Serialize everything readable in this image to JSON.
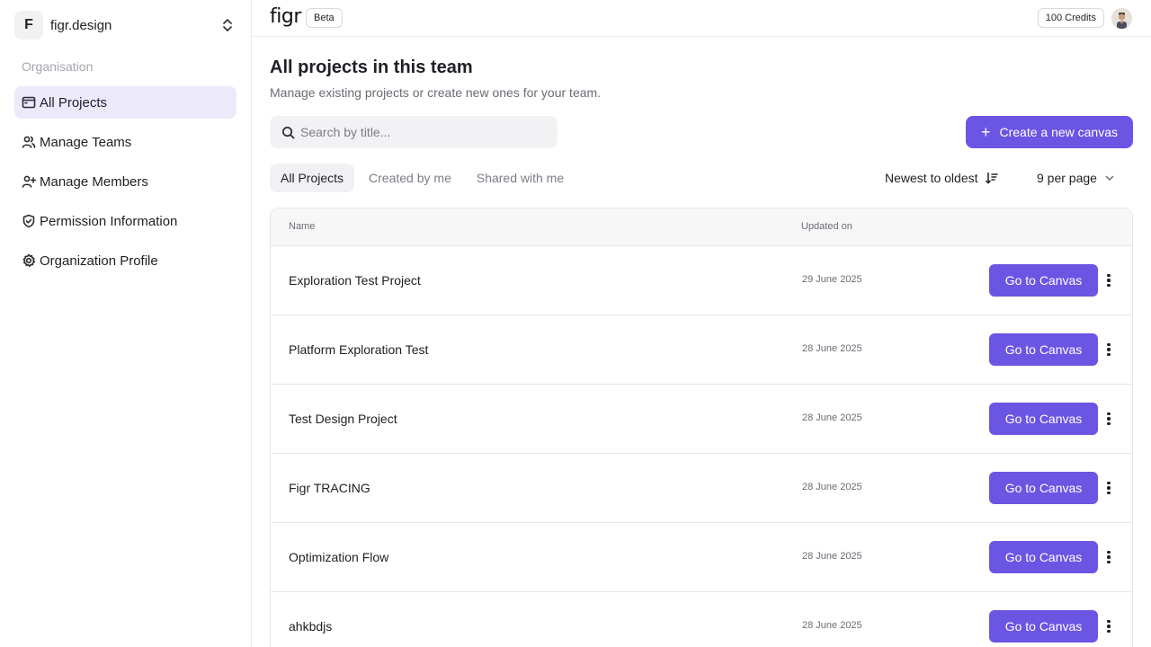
{
  "team": {
    "initial": "F",
    "name": "figr.design"
  },
  "sidebar": {
    "section_label": "Organisation",
    "items": [
      {
        "label": "All Projects",
        "icon": "projects-icon",
        "active": true
      },
      {
        "label": "Manage Teams",
        "icon": "users-icon"
      },
      {
        "label": "Manage Members",
        "icon": "user-plus-icon"
      },
      {
        "label": "Permission Information",
        "icon": "shield-check-icon"
      },
      {
        "label": "Organization Profile",
        "icon": "gear-icon"
      }
    ]
  },
  "topbar": {
    "logo": "figr",
    "beta_label": "Beta",
    "credits_label": "100 Credits"
  },
  "main": {
    "title": "All projects in this team",
    "subtitle": "Manage existing projects or create new ones for your team.",
    "search_placeholder": "Search by title...",
    "create_button": "Create a new canvas",
    "tabs": [
      {
        "label": "All Projects",
        "active": true
      },
      {
        "label": "Created by me"
      },
      {
        "label": "Shared with me"
      }
    ],
    "sort_label": "Newest to oldest",
    "per_page_label": "9 per page"
  },
  "table": {
    "columns": {
      "name": "Name",
      "updated": "Updated on"
    },
    "action_label": "Go to Canvas",
    "rows": [
      {
        "name": "Exploration Test Project",
        "updated": "29 June 2025"
      },
      {
        "name": "Platform Exploration Test",
        "updated": "28 June 2025"
      },
      {
        "name": "Test Design Project",
        "updated": "28 June 2025"
      },
      {
        "name": "Figr TRACING",
        "updated": "28 June 2025"
      },
      {
        "name": "Optimization Flow",
        "updated": "28 June 2025"
      },
      {
        "name": "ahkbdjs",
        "updated": "28 June 2025"
      }
    ]
  },
  "colors": {
    "accent": "#6b55e3",
    "active_nav_bg": "#ece9fb"
  }
}
